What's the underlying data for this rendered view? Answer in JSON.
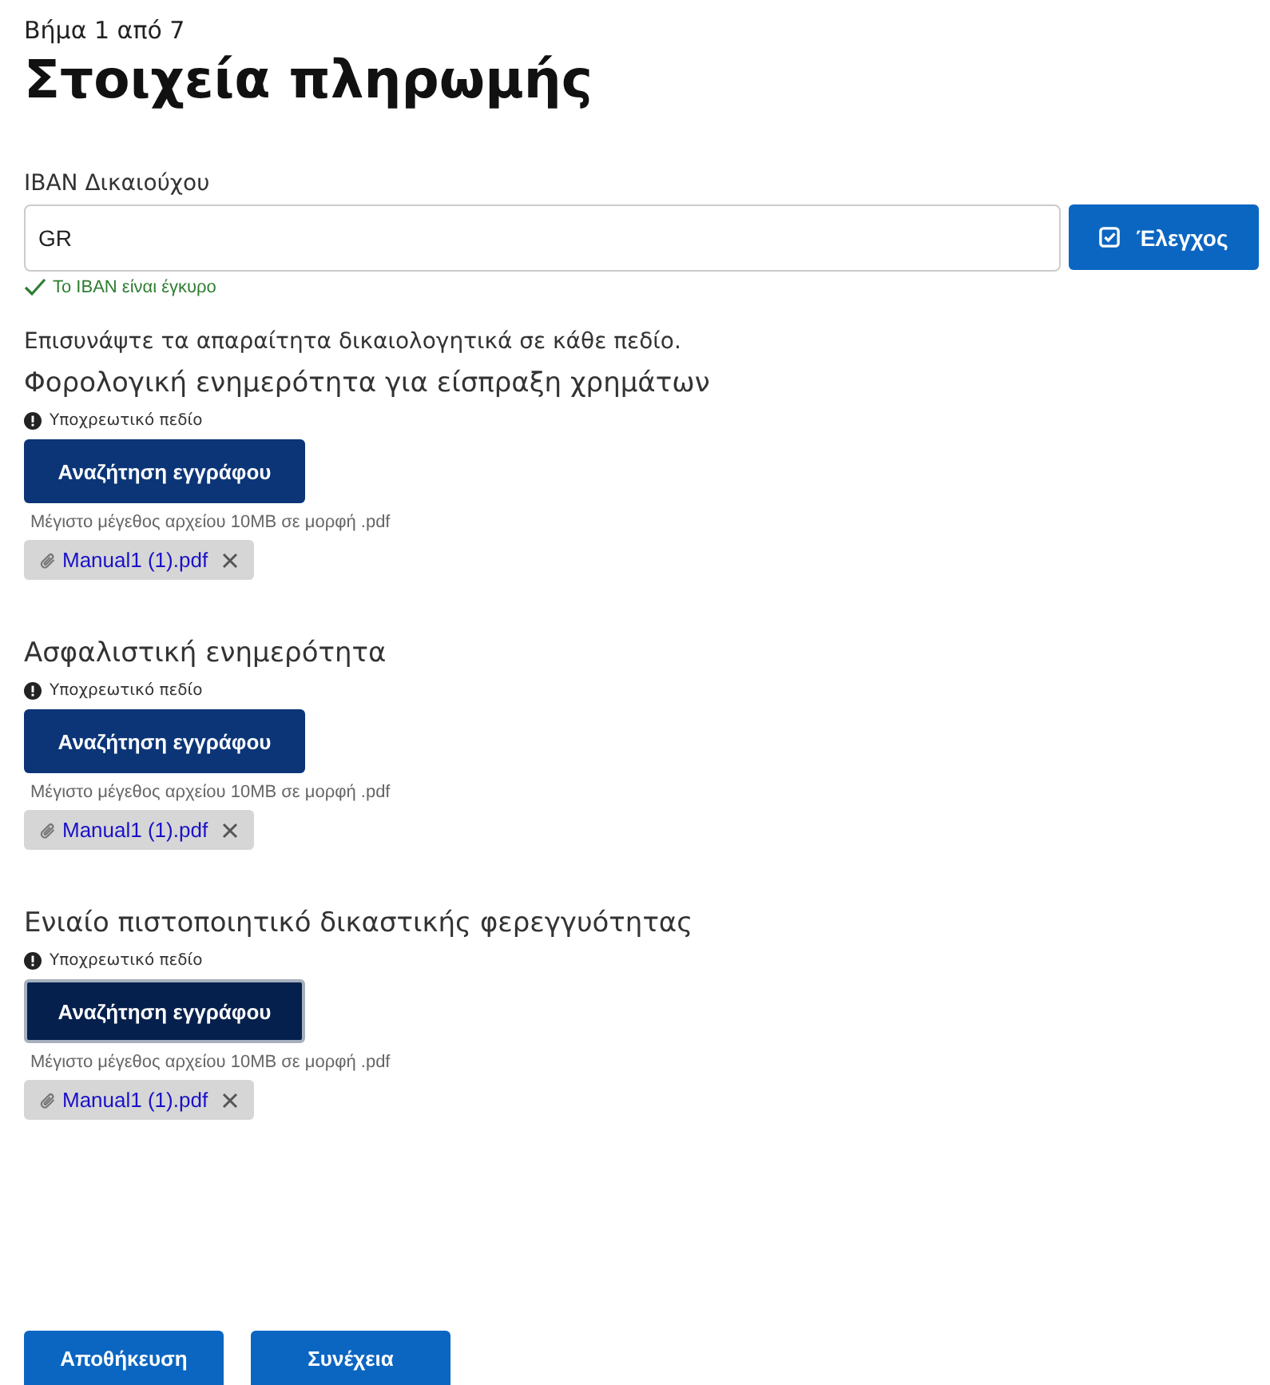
{
  "step": "Βήμα 1 από 7",
  "title": "Στοιχεία πληρωμής",
  "iban": {
    "label": "IBAN Δικαιούχου",
    "value": "GR",
    "check_button": "Έλεγχος",
    "valid": true,
    "message": "Το IBAN είναι έγκυρο"
  },
  "instruction": "Επισυνάψτε τα απαραίτητα δικαιολογητικά σε κάθε πεδίο.",
  "documents": [
    {
      "title": "Φορολογική ενημερότητα για είσπραξη χρημάτων",
      "required": "Υποχρεωτικό πεδίο",
      "button": "Αναζήτηση εγγράφου",
      "focused": false,
      "hint": "Μέγιστο μέγεθος αρχείου 10MB σε μορφή .pdf",
      "files": [
        "Manual1 (1).pdf"
      ]
    },
    {
      "title": "Ασφαλιστική ενημερότητα",
      "required": "Υποχρεωτικό πεδίο",
      "button": "Αναζήτηση εγγράφου",
      "focused": false,
      "hint": "Μέγιστο μέγεθος αρχείου 10MB σε μορφή .pdf",
      "files": [
        "Manual1 (1).pdf"
      ]
    },
    {
      "title": "Ενιαίο πιστοποιητικό δικαστικής φερεγγυότητας",
      "required": "Υποχρεωτικό πεδίο",
      "button": "Αναζήτηση εγγράφου",
      "focused": true,
      "hint": "Μέγιστο μέγεθος αρχείου 10MB σε μορφή .pdf",
      "files": [
        "Manual1 (1).pdf"
      ]
    }
  ],
  "actions": [
    "Αποθήκευση",
    "Συνέχεια"
  ]
}
